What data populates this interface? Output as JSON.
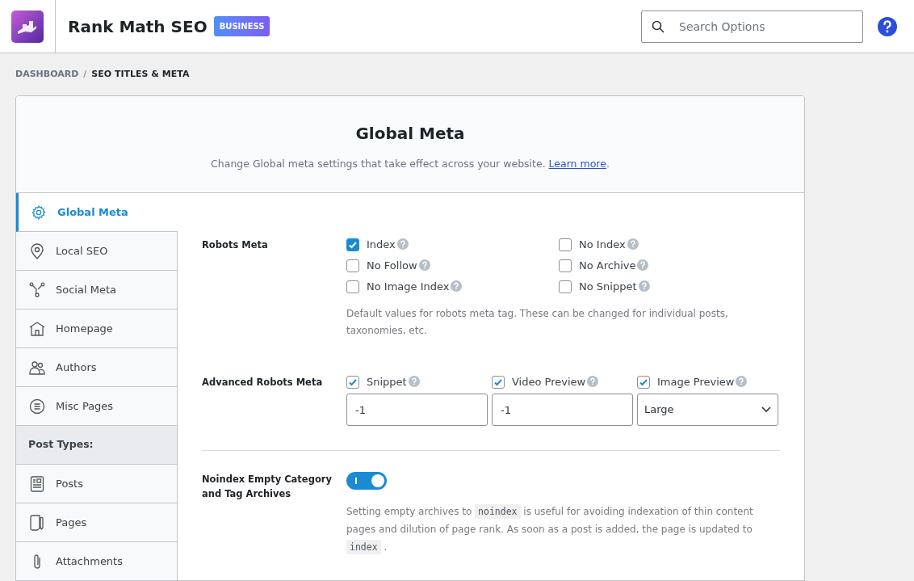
{
  "header": {
    "title": "Rank Math SEO",
    "badge": "BUSINESS",
    "search": {
      "placeholder": "Search Options"
    }
  },
  "breadcrumb": {
    "items": [
      "DASHBOARD",
      "SEO TITLES & META"
    ],
    "separator": "/"
  },
  "panel": {
    "title": "Global Meta",
    "subtitle": "Change Global meta settings that take effect across your website. ",
    "link": "Learn more",
    "after_link": "."
  },
  "sidebar": {
    "items": [
      {
        "kind": "item",
        "label": "Global Meta",
        "selected": true
      },
      {
        "kind": "item",
        "label": "Local SEO",
        "selected": false
      },
      {
        "kind": "item",
        "label": "Social Meta",
        "selected": false
      },
      {
        "kind": "item",
        "label": "Homepage",
        "selected": false
      },
      {
        "kind": "item",
        "label": "Authors",
        "selected": false
      },
      {
        "kind": "item",
        "label": "Misc Pages",
        "selected": false
      },
      {
        "kind": "heading",
        "label": "Post Types:"
      },
      {
        "kind": "item",
        "label": "Posts",
        "selected": false
      },
      {
        "kind": "item",
        "label": "Pages",
        "selected": false
      },
      {
        "kind": "item",
        "label": "Attachments",
        "selected": false
      }
    ]
  },
  "robots_meta": {
    "label": "Robots Meta",
    "options": [
      {
        "label": "Index",
        "checked": true
      },
      {
        "label": "No Index",
        "checked": false
      },
      {
        "label": "No Follow",
        "checked": false
      },
      {
        "label": "No Archive",
        "checked": false
      },
      {
        "label": "No Image Index",
        "checked": false
      },
      {
        "label": "No Snippet",
        "checked": false
      }
    ],
    "description": "Default values for robots meta tag. These can be changed for individual posts, taxonomies, etc."
  },
  "advanced_robots_meta": {
    "label": "Advanced Robots Meta",
    "options": [
      {
        "label": "Snippet",
        "checked": true,
        "kind": "input",
        "value": "-1"
      },
      {
        "label": "Video Preview",
        "checked": true,
        "kind": "input",
        "value": "-1"
      },
      {
        "label": "Image Preview",
        "checked": true,
        "kind": "select",
        "value": "Large"
      }
    ]
  },
  "noindex_empty": {
    "label": "Noindex Empty Category and Tag Archives",
    "on": true,
    "description": [
      {
        "kind": "text",
        "text": "Setting empty archives to "
      },
      {
        "kind": "code",
        "text": "noindex"
      },
      {
        "kind": "text",
        "text": " is useful for avoiding indexation of thin content pages and dilution of page rank. As soon as a post is added, the page is updated to "
      },
      {
        "kind": "code",
        "text": "index"
      },
      {
        "kind": "text",
        "text": " ."
      }
    ]
  }
}
